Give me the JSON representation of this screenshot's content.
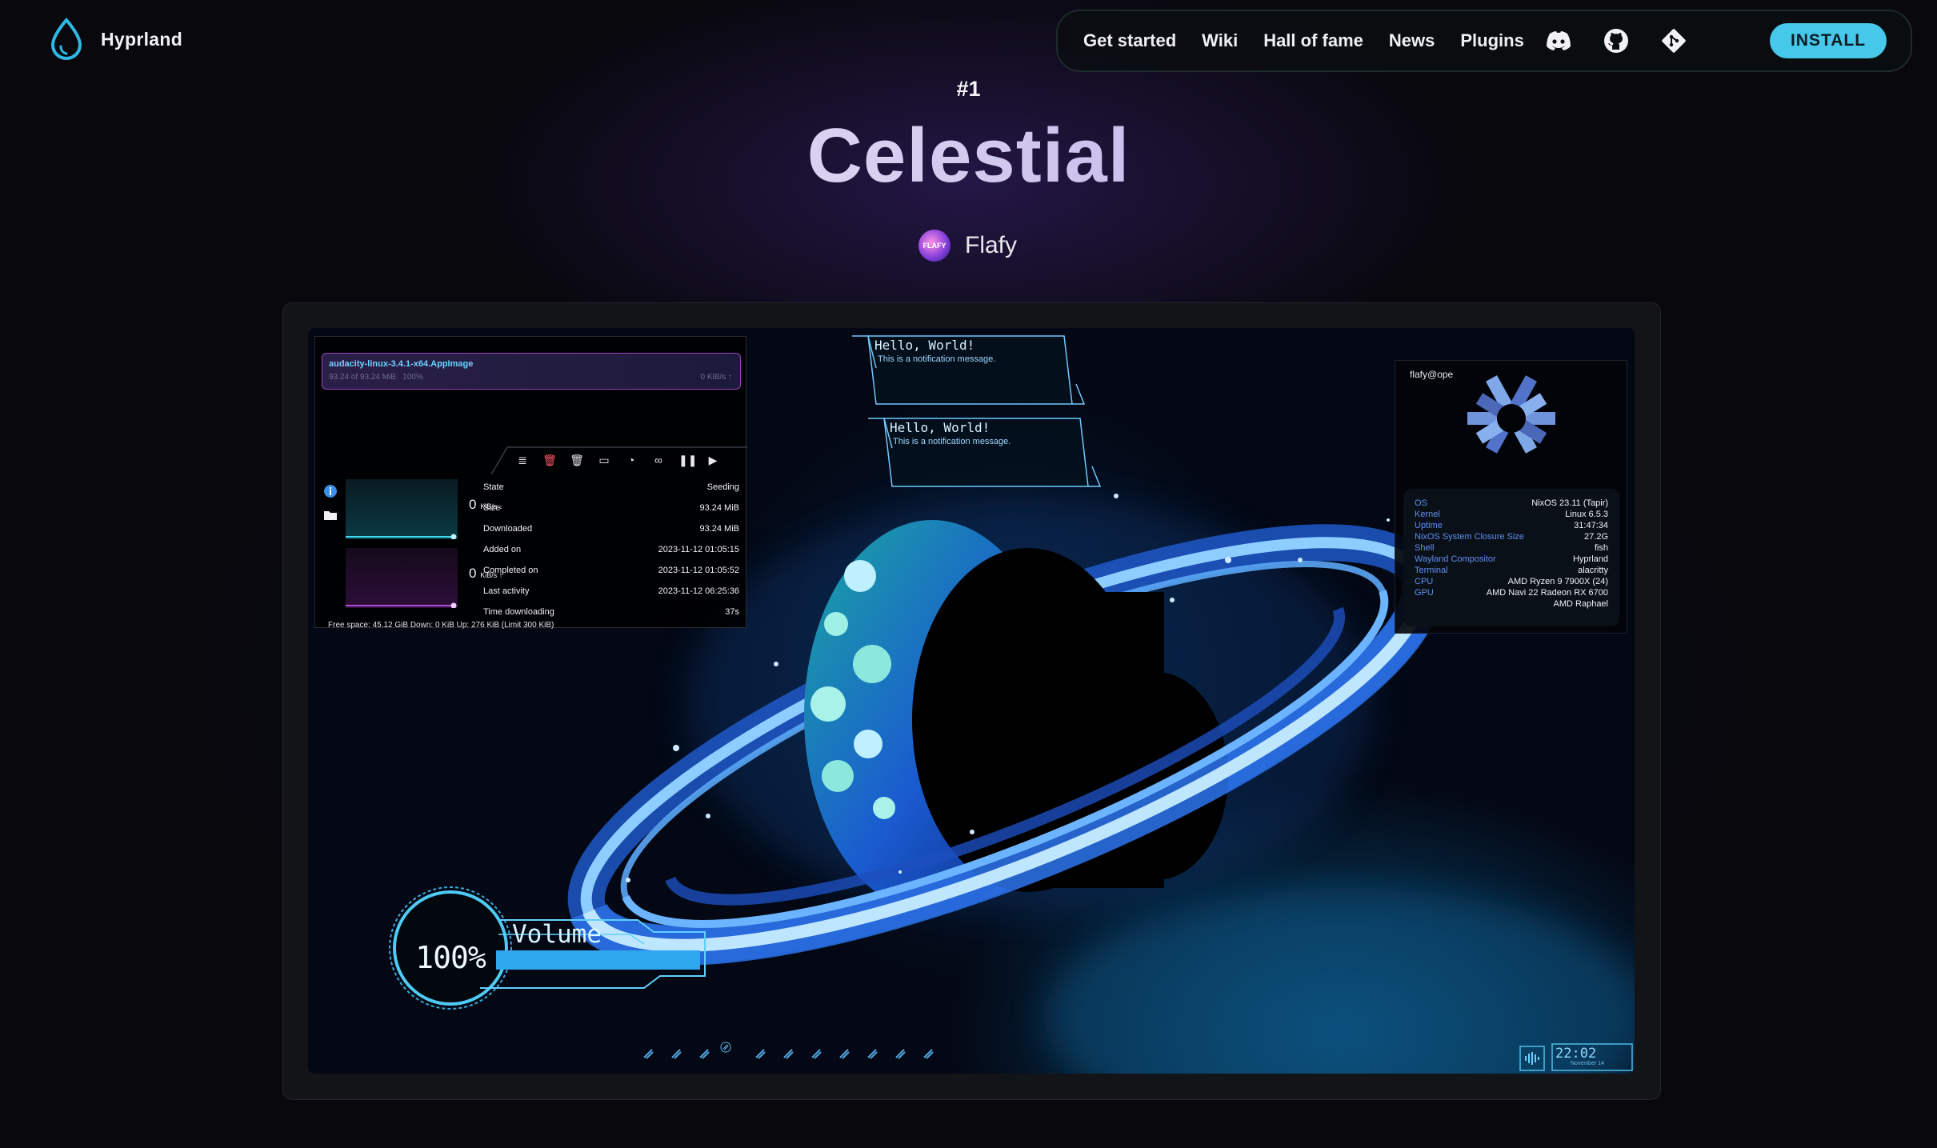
{
  "brand": {
    "name": "Hyprland",
    "logo_icon": "hyprland-drop-icon"
  },
  "nav": {
    "links": [
      "Get started",
      "Wiki",
      "Hall of fame",
      "News",
      "Plugins"
    ],
    "icons": [
      "discord-icon",
      "github-icon",
      "git-icon"
    ],
    "install_label": "INSTALL"
  },
  "hero": {
    "rank": "#1",
    "title": "Celestial",
    "author": "Flafy",
    "avatar_text": "FLAFY"
  },
  "screenshot": {
    "torrent": {
      "item_name": "audacity-linux-3.4.1-x64.AppImage",
      "item_progress": "93.24 of 93.24 MiB",
      "item_percent": "100%",
      "item_speed": "0 KiB/s",
      "down_rate": "0",
      "down_unit": "KiB/s",
      "up_rate": "0",
      "up_unit": "KiB/s",
      "details": [
        {
          "key": "State",
          "value": "Seeding"
        },
        {
          "key": "Size",
          "value": "93.24 MiB"
        },
        {
          "key": "Downloaded",
          "value": "93.24 MiB"
        },
        {
          "key": "Added on",
          "value": "2023-11-12 01:05:15"
        },
        {
          "key": "Completed on",
          "value": "2023-11-12 01:05:52"
        },
        {
          "key": "Last activity",
          "value": "2023-11-12 06:25:36"
        },
        {
          "key": "Time downloading",
          "value": "37s"
        }
      ],
      "footer": "Free space: 45.12 GiB     Down: 0 KiB     Up: 276 KiB (Limit 300 KiB)"
    },
    "notifications": [
      {
        "title": "Hello, World!",
        "body": "This is a notification message."
      },
      {
        "title": "Hello, World!",
        "body": "This is a notification message."
      }
    ],
    "fetch": {
      "user": "flafy@ope",
      "rows": [
        {
          "key": "OS",
          "value": "NixOS 23.11 (Tapir)"
        },
        {
          "key": "Kernel",
          "value": "Linux 6.5.3"
        },
        {
          "key": "Uptime",
          "value": "31:47:34"
        },
        {
          "key": "NixOS System Closure Size",
          "value": "27.2G"
        },
        {
          "key": "Shell",
          "value": "fish"
        },
        {
          "key": "Wayland Compositor",
          "value": "Hyprland"
        },
        {
          "key": "Terminal",
          "value": "alacritty"
        },
        {
          "key": "CPU",
          "value": "AMD Ryzen 9 7900X (24)"
        },
        {
          "key": "GPU",
          "value": "AMD Navi 22 Radeon RX 6700"
        },
        {
          "key": "",
          "value": "AMD Raphael"
        }
      ]
    },
    "volume": {
      "percent_label": "100%",
      "label": "Volume",
      "level": 1.0
    },
    "workspaces": {
      "count": 11,
      "active_index": 3
    },
    "clock": {
      "time": "22:02",
      "date": "November 14"
    }
  },
  "colors": {
    "accent": "#45c8ea",
    "background": "#08080d",
    "title_gradient_start": "#e9e4f6",
    "title_gradient_end": "#9c8ee0"
  }
}
